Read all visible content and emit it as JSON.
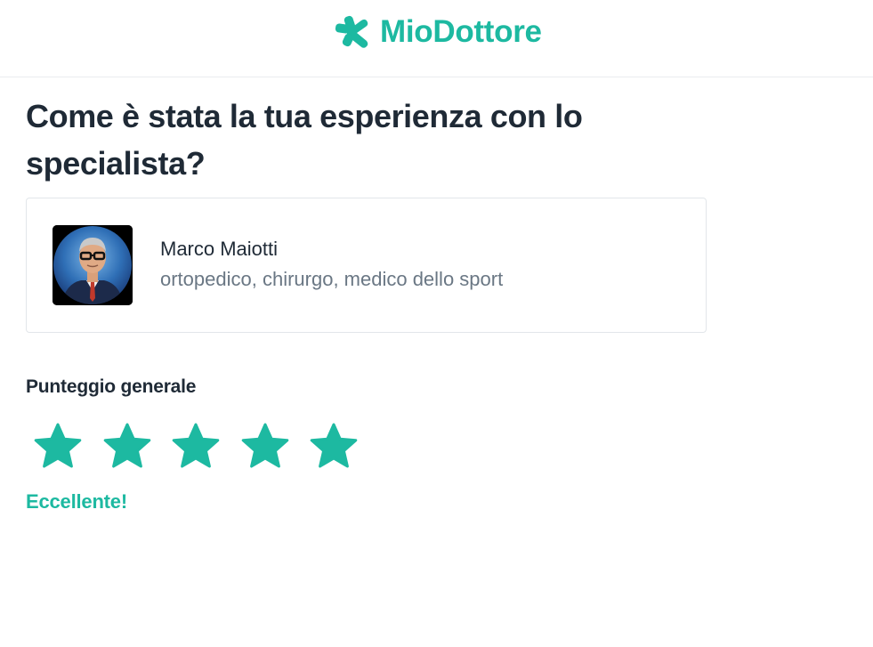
{
  "header": {
    "brand_name": "MioDottore",
    "logo_icon": "miodottore-logo-icon",
    "brand_color": "#1db9a1"
  },
  "page": {
    "title": "Come è stata la tua esperienza con lo specialista?"
  },
  "doctor": {
    "name": "Marco Maiotti",
    "specialties": "ortopedico, chirurgo, medico dello sport",
    "avatar_icon": "doctor-photo"
  },
  "rating": {
    "label": "Punteggio generale",
    "value": 5,
    "max": 5,
    "result_text": "Eccellente!",
    "star_color": "#1db9a1",
    "star_icon": "star-icon"
  }
}
